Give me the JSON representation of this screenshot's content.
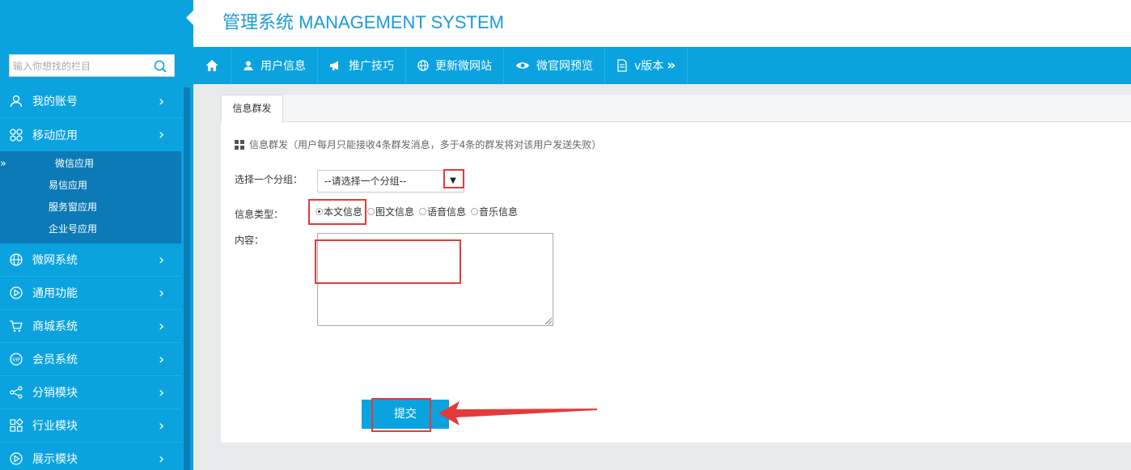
{
  "header": {
    "title": "管理系统 MANAGEMENT SYSTEM"
  },
  "search": {
    "placeholder": "输入你想找的栏目"
  },
  "sidebar": {
    "items": [
      {
        "label": "我的账号",
        "icon": "user-icon"
      },
      {
        "label": "移动应用",
        "icon": "apps-icon",
        "children": [
          {
            "label": "微信应用",
            "active": true
          },
          {
            "label": "易信应用"
          },
          {
            "label": "服务窗应用"
          },
          {
            "label": "企业号应用"
          }
        ]
      },
      {
        "label": "微网系统",
        "icon": "globe-icon"
      },
      {
        "label": "通用功能",
        "icon": "play-icon"
      },
      {
        "label": "商城系统",
        "icon": "cart-icon"
      },
      {
        "label": "会员系统",
        "icon": "vip-icon"
      },
      {
        "label": "分销模块",
        "icon": "share-icon"
      },
      {
        "label": "行业模块",
        "icon": "grid-icon"
      },
      {
        "label": "展示模块",
        "icon": "play-icon"
      }
    ],
    "active_mark": "»",
    "arrow": "›"
  },
  "topnav": {
    "items": [
      {
        "label": "用户信息",
        "icon": "user-icon"
      },
      {
        "label": "推广技巧",
        "icon": "megaphone-icon"
      },
      {
        "label": "更新微网站",
        "icon": "globe-icon"
      },
      {
        "label": "微官网预览",
        "icon": "eye-icon"
      },
      {
        "label": "v版本",
        "icon": "document-icon"
      }
    ],
    "more": "»"
  },
  "main": {
    "tab": "信息群发",
    "note": "信息群发（用户每月只能接收4条群发消息，多于4条的群发将对该用户发送失败）",
    "group_label": "选择一个分组：",
    "group_select_value": "--请选择一个分组--",
    "type_label": "信息类型：",
    "types": [
      {
        "label": "本文信息",
        "checked": true
      },
      {
        "label": "图文信息",
        "checked": false
      },
      {
        "label": "语音信息",
        "checked": false
      },
      {
        "label": "音乐信息",
        "checked": false
      }
    ],
    "content_label": "内容：",
    "content_value": "",
    "submit_label": "提交"
  },
  "colors": {
    "primary": "#0aa3df",
    "submenu": "#0c7ab6",
    "annotation": "#e33b3b",
    "title": "#1a9bd6"
  }
}
